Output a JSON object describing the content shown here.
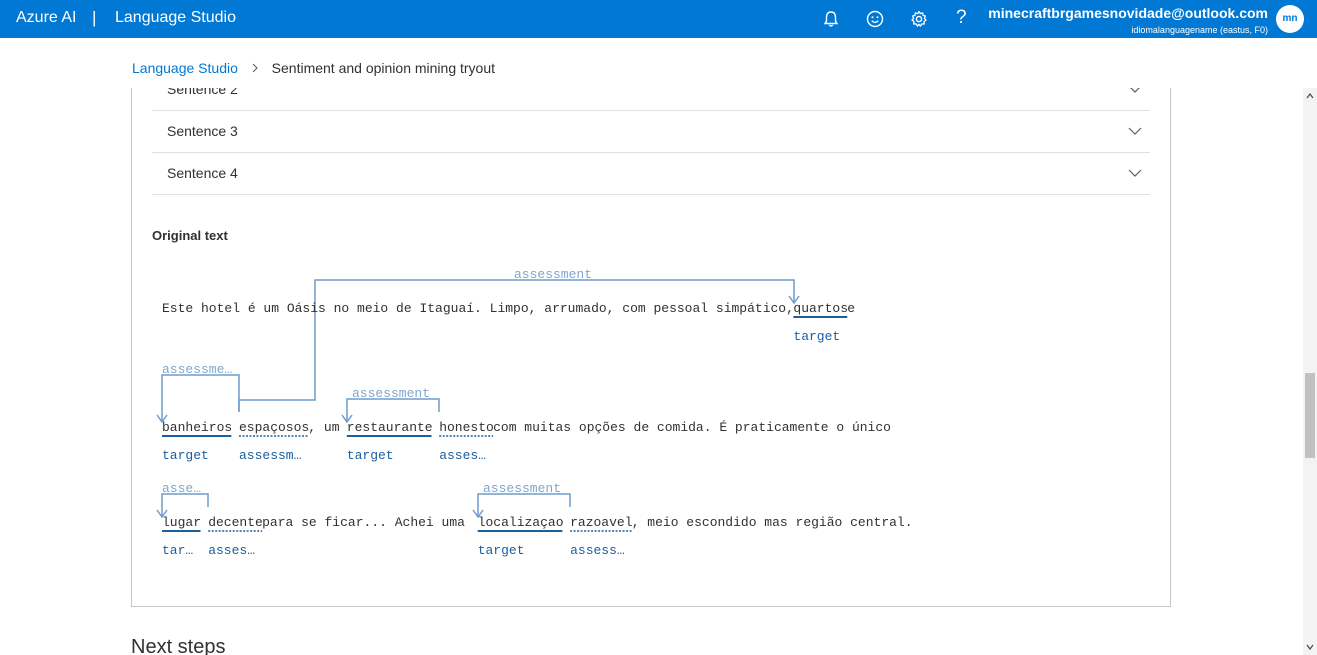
{
  "header": {
    "brand": "Azure AI",
    "separator": "|",
    "product": "Language Studio",
    "account_email": "minecraftbrgamesnovidade@outlook.com",
    "account_directory": "idiomalanguagename (eastus, F0)",
    "avatar_initials": "mn",
    "icons": [
      "bell-icon",
      "smiley-icon",
      "gear-icon",
      "help-icon"
    ],
    "help_glyph": "?"
  },
  "breadcrumb": {
    "root": "Language Studio",
    "current": "Sentiment and opinion mining tryout"
  },
  "sentences": [
    {
      "label": "Sentence 2"
    },
    {
      "label": "Sentence 3"
    },
    {
      "label": "Sentence 4"
    }
  ],
  "original_text": {
    "title": "Original text",
    "lines": [
      [
        {
          "text": "Este hotel é um Oásis no meio de Itaguaí. Limpo, arrumado, com pessoal simpático, "
        },
        {
          "text": "quartos",
          "role": "target",
          "label": "target"
        },
        {
          "text": " e"
        }
      ],
      [
        {
          "text": "banheiros",
          "role": "target",
          "label": "target"
        },
        {
          "text": " "
        },
        {
          "text": "espaçosos",
          "role": "assessment",
          "label": "assessm…"
        },
        {
          "text": ", um "
        },
        {
          "text": "restaurante",
          "role": "target",
          "label": "target"
        },
        {
          "text": " "
        },
        {
          "text": "honesto",
          "role": "assessment",
          "label": "asses…"
        },
        {
          "text": " com muitas opções de comida. É praticamente o único"
        }
      ],
      [
        {
          "text": "lugar",
          "role": "target",
          "label": "tar…"
        },
        {
          "text": " "
        },
        {
          "text": "decente",
          "role": "assessment",
          "label": "asses…"
        },
        {
          "text": " para se ficar... Achei uma "
        },
        {
          "text": "localizaçao",
          "role": "target",
          "label": "target"
        },
        {
          "text": " "
        },
        {
          "text": "razoavel",
          "role": "assessment",
          "label": "assess…"
        },
        {
          "text": ", meio escondido mas região central."
        }
      ]
    ],
    "arcs": [
      {
        "label": "assessment"
      },
      {
        "label": "assessme…"
      },
      {
        "label": "assessment"
      },
      {
        "label": "asse…"
      },
      {
        "label": "assessment"
      }
    ]
  },
  "next_steps": {
    "title": "Next steps"
  },
  "colors": {
    "accent": "#0078d4",
    "target": "#1a5fa0",
    "arc": "#6e9ccc",
    "arc_label": "#7fa6cf",
    "text": "#323130"
  }
}
